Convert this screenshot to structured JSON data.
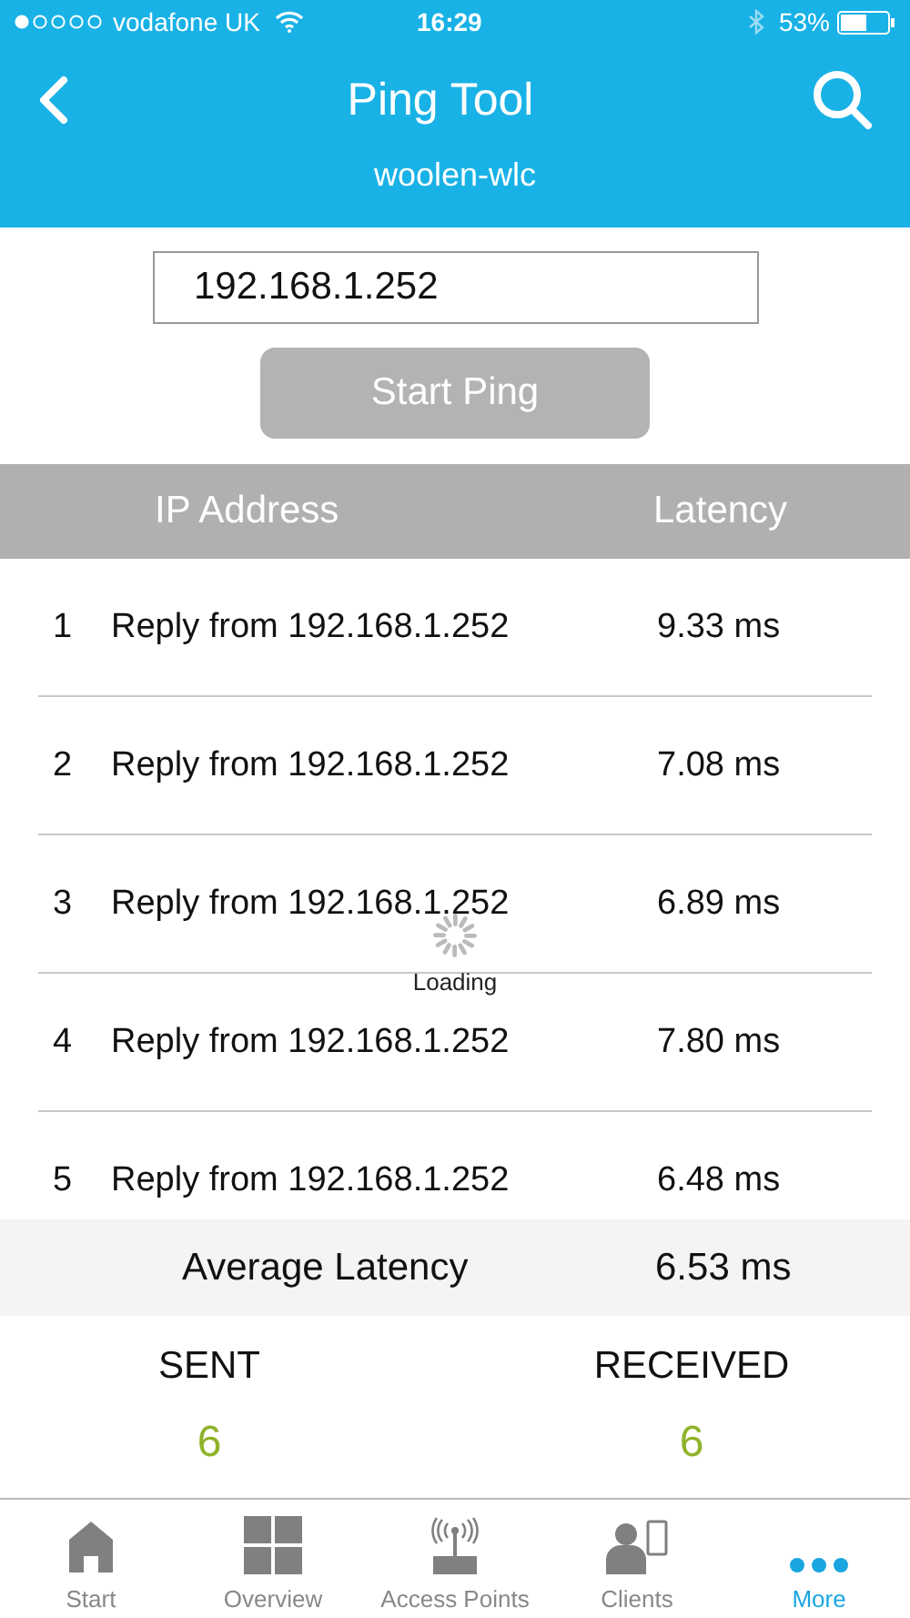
{
  "status_bar": {
    "carrier": "vodafone UK",
    "time": "16:29",
    "battery": "53%"
  },
  "nav": {
    "title": "Ping Tool",
    "subtitle": "woolen-wlc"
  },
  "ip_field": {
    "value": "192.168.1.252"
  },
  "start_button": {
    "label": "Start Ping",
    "disabled": true
  },
  "table": {
    "columns": [
      "IP Address",
      "Latency"
    ],
    "rows": [
      {
        "index": "1",
        "reply": "Reply from 192.168.1.252",
        "latency": "9.33 ms"
      },
      {
        "index": "2",
        "reply": "Reply from 192.168.1.252",
        "latency": "7.08 ms"
      },
      {
        "index": "3",
        "reply": "Reply from 192.168.1.252",
        "latency": "6.89 ms"
      },
      {
        "index": "4",
        "reply": "Reply from 192.168.1.252",
        "latency": "7.80 ms"
      },
      {
        "index": "5",
        "reply": "Reply from 192.168.1.252",
        "latency": "6.48 ms"
      }
    ]
  },
  "loading": {
    "label": "Loading"
  },
  "average": {
    "label": "Average Latency",
    "value": "6.53 ms"
  },
  "counts": [
    {
      "label": "SENT",
      "value": "6"
    },
    {
      "label": "RECEIVED",
      "value": "6"
    }
  ],
  "tab_bar": [
    {
      "kind": "home",
      "label": "Start",
      "selected": false
    },
    {
      "kind": "grid",
      "label": "Overview",
      "selected": false
    },
    {
      "kind": "antenna",
      "label": "Access Points",
      "selected": false
    },
    {
      "kind": "clients",
      "label": "Clients",
      "selected": false
    },
    {
      "kind": "more",
      "label": "More",
      "selected": true
    }
  ]
}
